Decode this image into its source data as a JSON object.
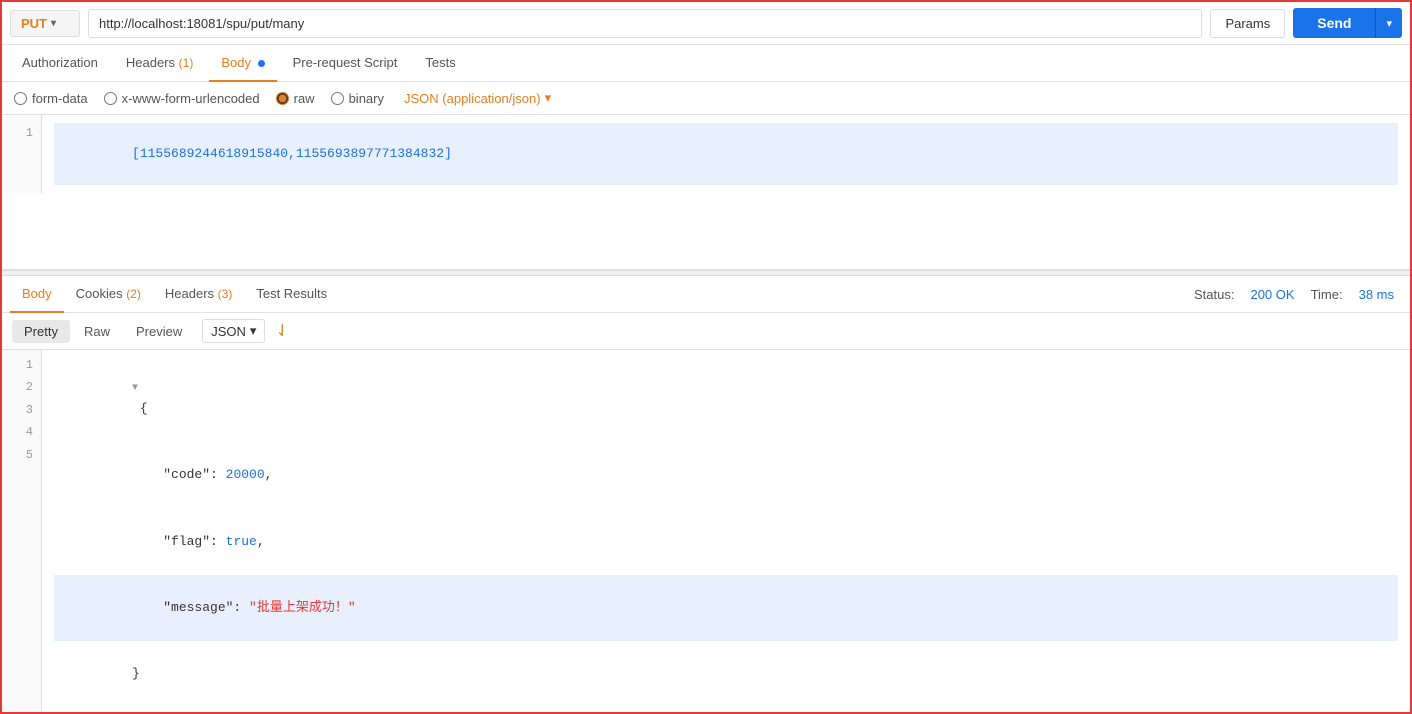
{
  "request": {
    "method": "PUT",
    "url": "http://localhost:18081/spu/put/many",
    "params_label": "Params",
    "send_label": "Send"
  },
  "request_tabs": [
    {
      "id": "authorization",
      "label": "Authorization",
      "active": false,
      "count": null,
      "dot": false
    },
    {
      "id": "headers",
      "label": "Headers",
      "active": false,
      "count": "(1)",
      "dot": false
    },
    {
      "id": "body",
      "label": "Body",
      "active": true,
      "count": null,
      "dot": true
    },
    {
      "id": "pre-request",
      "label": "Pre-request Script",
      "active": false,
      "count": null,
      "dot": false
    },
    {
      "id": "tests",
      "label": "Tests",
      "active": false,
      "count": null,
      "dot": false
    }
  ],
  "body_options": {
    "form_data": "form-data",
    "urlencoded": "x-www-form-urlencoded",
    "raw": "raw",
    "binary": "binary",
    "json_type": "JSON (application/json)"
  },
  "request_body": {
    "line1": "[1155689244618915840,1155693897771384832]"
  },
  "response_tabs": [
    {
      "id": "body",
      "label": "Body",
      "active": true
    },
    {
      "id": "cookies",
      "label": "Cookies",
      "count": "(2)",
      "active": false
    },
    {
      "id": "headers",
      "label": "Headers",
      "count": "(3)",
      "active": false
    },
    {
      "id": "test-results",
      "label": "Test Results",
      "active": false
    }
  ],
  "response_status": {
    "status_label": "Status:",
    "status_value": "200 OK",
    "time_label": "Time:",
    "time_value": "38 ms"
  },
  "response_view": {
    "pretty_label": "Pretty",
    "raw_label": "Raw",
    "preview_label": "Preview",
    "json_label": "JSON",
    "wrap_icon": "≡"
  },
  "response_body": {
    "lines": [
      {
        "num": "1",
        "content": "{",
        "highlighted": false,
        "has_arrow": true
      },
      {
        "num": "2",
        "content": "    \"code\": 20000,",
        "highlighted": false
      },
      {
        "num": "3",
        "content": "    \"flag\": true,",
        "highlighted": false
      },
      {
        "num": "4",
        "content": "    \"message\": \"批量上架成功！\"",
        "highlighted": true
      },
      {
        "num": "5",
        "content": "}",
        "highlighted": false
      }
    ]
  }
}
